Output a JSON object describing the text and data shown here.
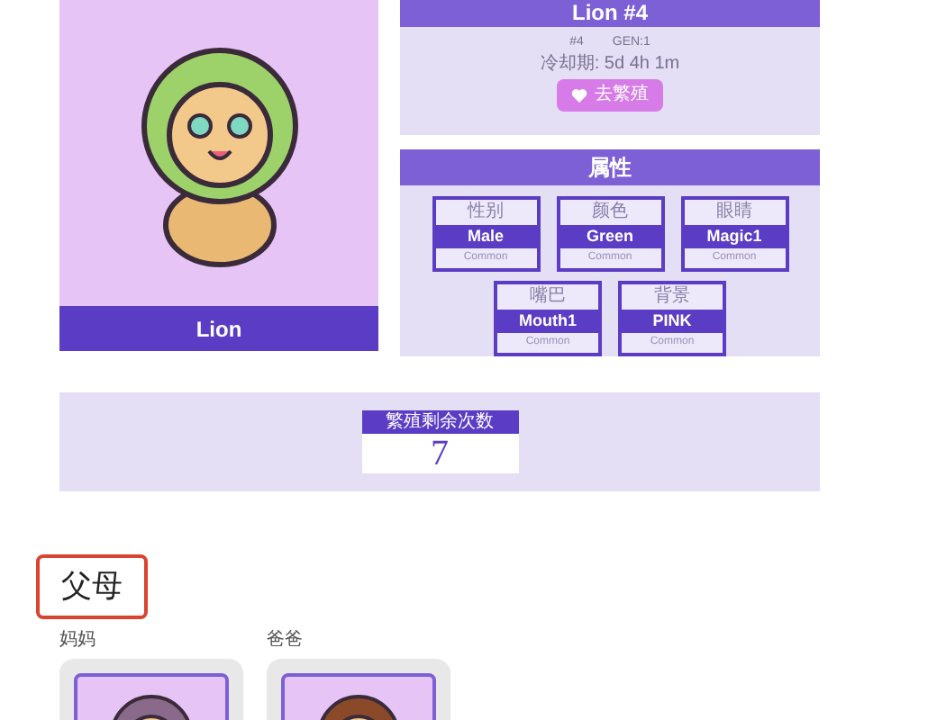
{
  "card": {
    "name": "Lion"
  },
  "info": {
    "title": "Lion #4",
    "number": "#4",
    "generation": "GEN:1",
    "cooldown": "冷却期: 5d 4h 1m",
    "breed_button": "去繁殖"
  },
  "attributes": {
    "title": "属性",
    "items": [
      {
        "label": "性别",
        "value": "Male",
        "rarity": "Common"
      },
      {
        "label": "颜色",
        "value": "Green",
        "rarity": "Common"
      },
      {
        "label": "眼睛",
        "value": "Magic1",
        "rarity": "Common"
      },
      {
        "label": "嘴巴",
        "value": "Mouth1",
        "rarity": "Common"
      },
      {
        "label": "背景",
        "value": "PINK",
        "rarity": "Common"
      }
    ]
  },
  "breeding": {
    "label": "繁殖剩余次数",
    "value": "7"
  },
  "parents": {
    "title": "父母",
    "items": [
      {
        "label": "妈妈"
      },
      {
        "label": "爸爸"
      }
    ]
  }
}
